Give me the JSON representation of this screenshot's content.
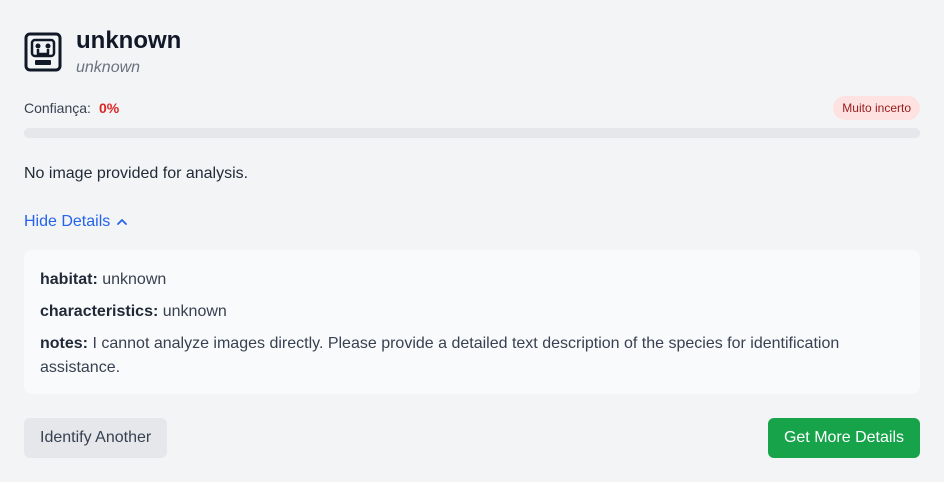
{
  "result": {
    "title": "unknown",
    "subtitle": "unknown",
    "icon": "robot-face-icon"
  },
  "confidence": {
    "label": "Confiança:",
    "value_text": "0%",
    "value_percent": 0,
    "badge": "Muito incerto",
    "colors": {
      "value": "#dc2626",
      "badge_bg": "#fee2e2",
      "badge_text": "#991b1b"
    }
  },
  "description": "No image provided for analysis.",
  "details_toggle": {
    "label": "Hide Details",
    "icon": "chevron-up-icon"
  },
  "details": [
    {
      "key": "habitat:",
      "value": "unknown"
    },
    {
      "key": "characteristics:",
      "value": "unknown"
    },
    {
      "key": "notes:",
      "value": "I cannot analyze images directly. Please provide a detailed text description of the species for identification assistance."
    }
  ],
  "actions": {
    "secondary_label": "Identify Another",
    "primary_label": "Get More Details",
    "primary_color": "#16a34a"
  }
}
